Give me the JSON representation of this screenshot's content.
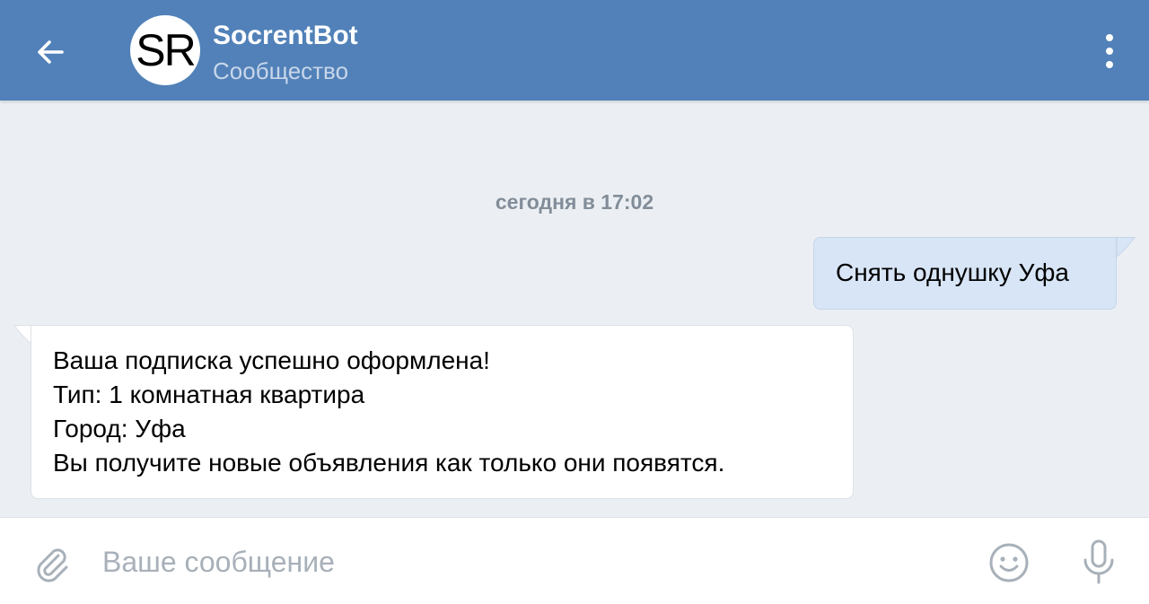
{
  "header": {
    "title": "SocrentBot",
    "subtitle": "Сообщество",
    "avatar_text": "SR",
    "background_color": "#5181b8",
    "back_icon": "arrow-left-icon",
    "menu_icon": "more-vertical-icon"
  },
  "chat": {
    "date_separator": "сегодня в 17:02",
    "background_color": "#ebeff3",
    "messages": [
      {
        "direction": "outgoing",
        "lines": [
          "Снять однушку Уфа"
        ],
        "bubble_color": "#d8e5f6"
      },
      {
        "direction": "incoming",
        "lines": [
          "Ваша подписка успешно оформлена!",
          "Тип: 1 комнатная квартира",
          "Город: Уфа",
          "Вы получите новые объявления как только они появятся."
        ],
        "bubble_color": "#ffffff"
      }
    ]
  },
  "composer": {
    "placeholder": "Ваше сообщение",
    "attach_icon": "paperclip-icon",
    "emoji_icon": "smiley-icon",
    "mic_icon": "microphone-icon"
  }
}
